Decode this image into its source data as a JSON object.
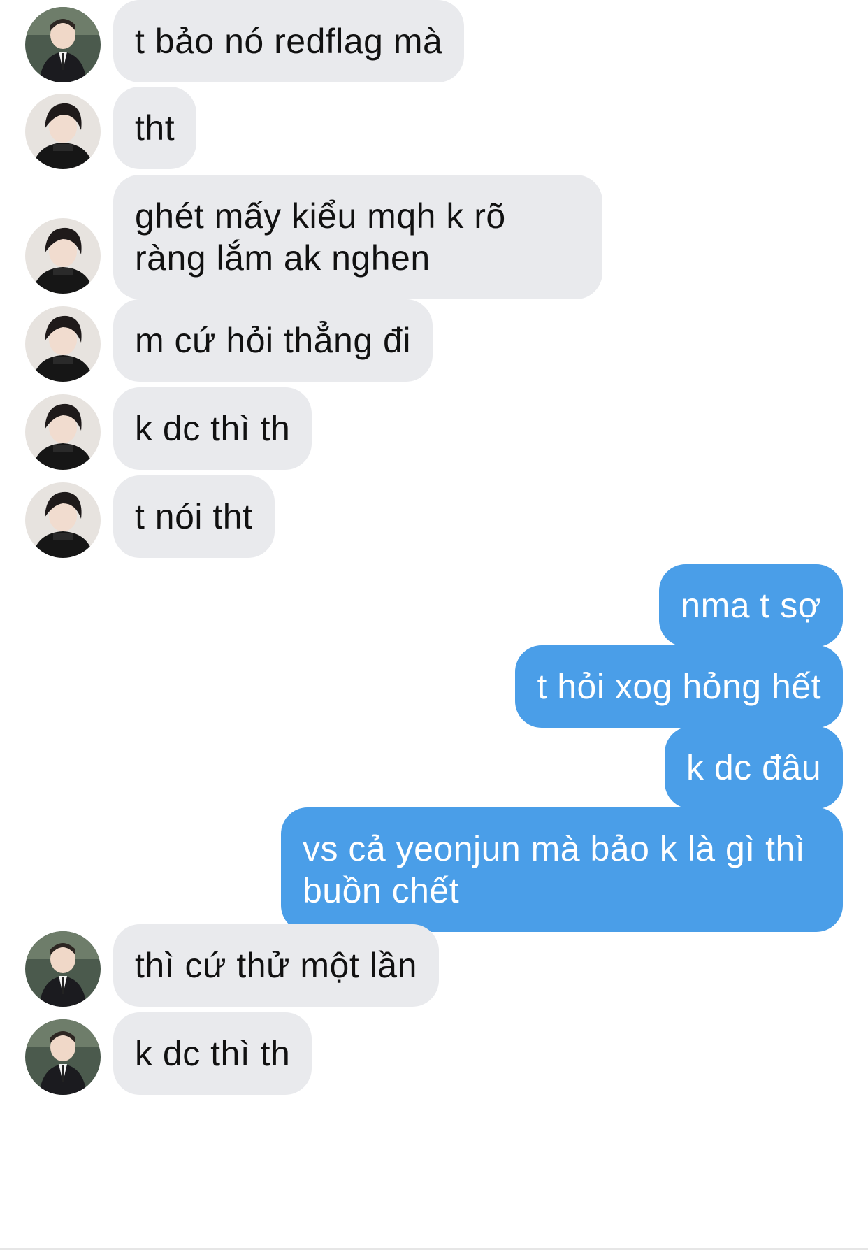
{
  "conversation": {
    "colors": {
      "incoming_bubble": "#e9eaed",
      "outgoing_bubble": "#4a9ee8",
      "incoming_text": "#111111",
      "outgoing_text": "#ffffff"
    },
    "messages": [
      {
        "side": "incoming",
        "avatar": "contact-a-avatar",
        "text": "t bảo nó redflag mà"
      },
      {
        "side": "incoming",
        "avatar": "contact-b-avatar",
        "text": "tht"
      },
      {
        "side": "incoming",
        "avatar": "contact-b-avatar",
        "text": "ghét mấy kiểu mqh k rõ ràng lắm ak nghen"
      },
      {
        "side": "incoming",
        "avatar": "contact-b-avatar",
        "text": "m cứ hỏi thẳng đi"
      },
      {
        "side": "incoming",
        "avatar": "contact-b-avatar",
        "text": "k dc thì th"
      },
      {
        "side": "incoming",
        "avatar": "contact-b-avatar",
        "text": "t nói tht"
      },
      {
        "side": "outgoing",
        "text": "nma t sợ"
      },
      {
        "side": "outgoing",
        "text": "t hỏi xog hỏng hết"
      },
      {
        "side": "outgoing",
        "text": "k dc đâu"
      },
      {
        "side": "outgoing",
        "text": "vs cả yeonjun mà bảo k là gì thì buồn chết"
      },
      {
        "side": "incoming",
        "avatar": "contact-a-avatar",
        "text": "thì cứ thử một lần"
      },
      {
        "side": "incoming",
        "avatar": "contact-a-avatar",
        "text": "k dc thì th"
      }
    ]
  }
}
